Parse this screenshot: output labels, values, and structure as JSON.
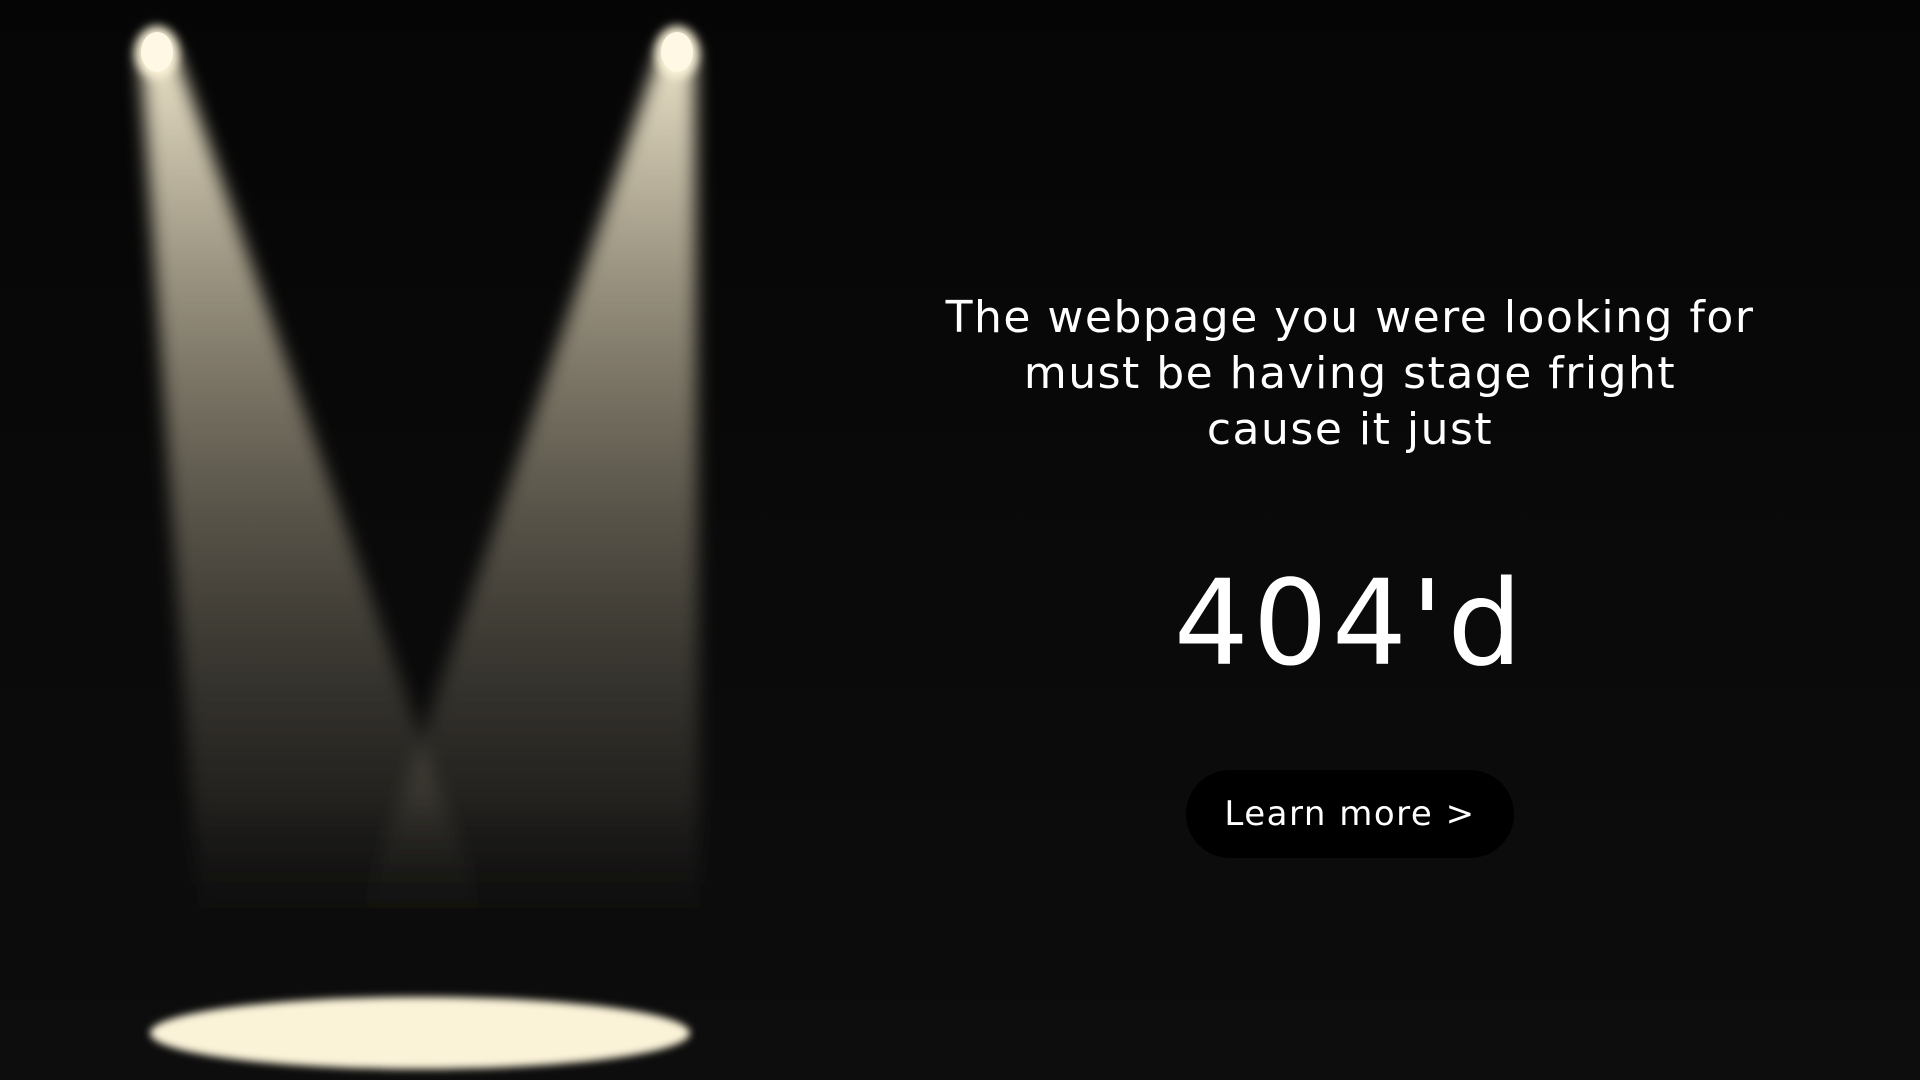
{
  "message": {
    "line1": "The webpage you were looking for",
    "line2": "must be having stage fright",
    "line3": "cause it just"
  },
  "error_code": "404'd",
  "learn_more_label": "Learn more >",
  "colors": {
    "background": "#0b0b0b",
    "spotlight": "#f5ecd0",
    "floor_spot": "#fbf3d8",
    "text": "#ffffff",
    "button": "#000000"
  }
}
